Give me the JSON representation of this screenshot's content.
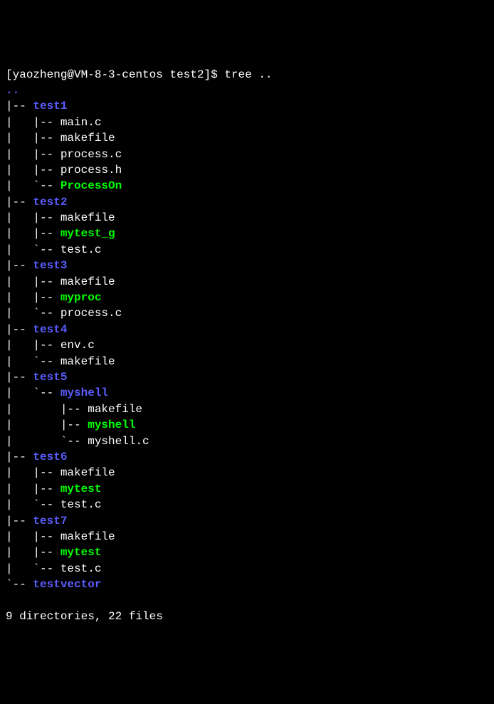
{
  "prompt": {
    "user": "yaozheng",
    "host": "VM-8-3-centos",
    "cwd": "test2",
    "command": "tree .."
  },
  "root": "..",
  "tree": [
    {
      "prefix": "|-- ",
      "name": "test1",
      "type": "dir"
    },
    {
      "prefix": "|   |-- ",
      "name": "main.c",
      "type": "file"
    },
    {
      "prefix": "|   |-- ",
      "name": "makefile",
      "type": "file"
    },
    {
      "prefix": "|   |-- ",
      "name": "process.c",
      "type": "file"
    },
    {
      "prefix": "|   |-- ",
      "name": "process.h",
      "type": "file"
    },
    {
      "prefix": "|   `-- ",
      "name": "ProcessOn",
      "type": "exe"
    },
    {
      "prefix": "|-- ",
      "name": "test2",
      "type": "dir"
    },
    {
      "prefix": "|   |-- ",
      "name": "makefile",
      "type": "file"
    },
    {
      "prefix": "|   |-- ",
      "name": "mytest_g",
      "type": "exe"
    },
    {
      "prefix": "|   `-- ",
      "name": "test.c",
      "type": "file"
    },
    {
      "prefix": "|-- ",
      "name": "test3",
      "type": "dir"
    },
    {
      "prefix": "|   |-- ",
      "name": "makefile",
      "type": "file"
    },
    {
      "prefix": "|   |-- ",
      "name": "myproc",
      "type": "exe"
    },
    {
      "prefix": "|   `-- ",
      "name": "process.c",
      "type": "file"
    },
    {
      "prefix": "|-- ",
      "name": "test4",
      "type": "dir"
    },
    {
      "prefix": "|   |-- ",
      "name": "env.c",
      "type": "file"
    },
    {
      "prefix": "|   `-- ",
      "name": "makefile",
      "type": "file"
    },
    {
      "prefix": "|-- ",
      "name": "test5",
      "type": "dir"
    },
    {
      "prefix": "|   `-- ",
      "name": "myshell",
      "type": "dir"
    },
    {
      "prefix": "|       |-- ",
      "name": "makefile",
      "type": "file"
    },
    {
      "prefix": "|       |-- ",
      "name": "myshell",
      "type": "exe"
    },
    {
      "prefix": "|       `-- ",
      "name": "myshell.c",
      "type": "file"
    },
    {
      "prefix": "|-- ",
      "name": "test6",
      "type": "dir"
    },
    {
      "prefix": "|   |-- ",
      "name": "makefile",
      "type": "file"
    },
    {
      "prefix": "|   |-- ",
      "name": "mytest",
      "type": "exe"
    },
    {
      "prefix": "|   `-- ",
      "name": "test.c",
      "type": "file"
    },
    {
      "prefix": "|-- ",
      "name": "test7",
      "type": "dir"
    },
    {
      "prefix": "|   |-- ",
      "name": "makefile",
      "type": "file"
    },
    {
      "prefix": "|   |-- ",
      "name": "mytest",
      "type": "exe"
    },
    {
      "prefix": "|   `-- ",
      "name": "test.c",
      "type": "file"
    },
    {
      "prefix": "`-- ",
      "name": "testvector",
      "type": "dir"
    }
  ],
  "summary": "9 directories, 22 files"
}
